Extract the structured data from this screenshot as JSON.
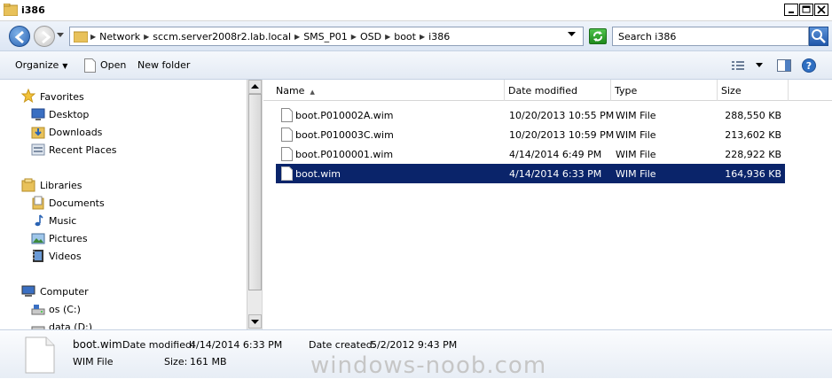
{
  "window": {
    "title": "i386"
  },
  "address_bar": {
    "crumbs": [
      "Network",
      "sccm.server2008r2.lab.local",
      "SMS_P01",
      "OSD",
      "boot",
      "i386"
    ],
    "search_placeholder": "Search i386"
  },
  "toolbar": {
    "organize_label": "Organize",
    "open_label": "Open",
    "new_folder_label": "New folder"
  },
  "nav": {
    "favorites": "Favorites",
    "desktop": "Desktop",
    "downloads": "Downloads",
    "recent_places": "Recent Places",
    "libraries": "Libraries",
    "documents": "Documents",
    "music": "Music",
    "pictures": "Pictures",
    "videos": "Videos",
    "computer": "Computer",
    "os_c": "os (C:)",
    "data_d": "data (D:)"
  },
  "columns": {
    "name": "Name",
    "date_modified": "Date modified",
    "type": "Type",
    "size": "Size"
  },
  "files": [
    {
      "name": "boot.P010002A.wim",
      "date": "10/20/2013 10:55 PM",
      "type": "WIM File",
      "size": "288,550 KB"
    },
    {
      "name": "boot.P010003C.wim",
      "date": "10/20/2013 10:59 PM",
      "type": "WIM File",
      "size": "213,602 KB"
    },
    {
      "name": "boot.P0100001.wim",
      "date": "4/14/2014 6:49 PM",
      "type": "WIM File",
      "size": "228,922 KB"
    },
    {
      "name": "boot.wim",
      "date": "4/14/2014 6:33 PM",
      "type": "WIM File",
      "size": "164,936 KB"
    }
  ],
  "selected_index": 3,
  "details": {
    "name": "boot.wim",
    "date_modified_label": "Date modified:",
    "date_modified_value": "4/14/2014 6:33 PM",
    "date_created_label": "Date created:",
    "date_created_value": "5/2/2012 9:43 PM",
    "type": "WIM File",
    "size_label": "Size:",
    "size_value": "161 MB"
  },
  "watermark": "windows-noob.com",
  "colors": {
    "selection": "#0a246a",
    "accent": "#2a63b3"
  }
}
